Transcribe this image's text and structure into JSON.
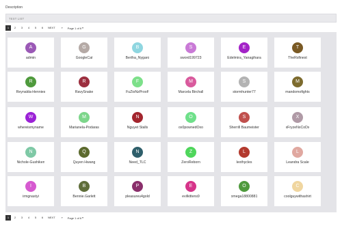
{
  "description_label": "Description",
  "list_header": "TEST LIST",
  "pager": {
    "pages": [
      "1",
      "2",
      "3",
      "4",
      "5",
      "6"
    ],
    "active": "1",
    "next_label": "NEXT",
    "last_label": "»",
    "page_of": "Page 1 of 6"
  },
  "users": [
    {
      "letter": "A",
      "name": "admin",
      "color": "#9b59b6"
    },
    {
      "letter": "G",
      "name": "GoogleCat",
      "color": "#b5aaa6"
    },
    {
      "letter": "B",
      "name": "Bertha_Nygaro",
      "color": "#8fd6e0"
    },
    {
      "letter": "S",
      "name": "sword199723",
      "color": "#c97ad6"
    },
    {
      "letter": "E",
      "name": "Edelmira_Yanagihara",
      "color": "#a323c7"
    },
    {
      "letter": "T",
      "name": "TheRsfinest",
      "color": "#7a5a25"
    },
    {
      "letter": "R",
      "name": "Reynalda-Hennies",
      "color": "#4f9a3d"
    },
    {
      "letter": "R",
      "name": "RavySnake",
      "color": "#9c2f3f"
    },
    {
      "letter": "F",
      "name": "FuZioNzProoF",
      "color": "#7de08a"
    },
    {
      "letter": "M",
      "name": "Marcela Birchall",
      "color": "#d95a9d"
    },
    {
      "letter": "S",
      "name": "stormhunter77",
      "color": "#b3b3b3"
    },
    {
      "letter": "M",
      "name": "mandomofights",
      "color": "#7d6b2e"
    },
    {
      "letter": "W",
      "name": "whereismyname",
      "color": "#9b22d6"
    },
    {
      "letter": "M",
      "name": "Marianela-Podaras",
      "color": "#7dd68b"
    },
    {
      "letter": "N",
      "name": "Nguyet Stalls",
      "color": "#a3262e"
    },
    {
      "letter": "O",
      "name": "ox0pownedOxo",
      "color": "#6fe08a"
    },
    {
      "letter": "S",
      "name": "Sherrill Baumeister",
      "color": "#c0504d"
    },
    {
      "letter": "X",
      "name": "xFryzeNxCoDx",
      "color": "#b09aa6"
    },
    {
      "letter": "N",
      "name": "Nichole-Gushiken",
      "color": "#7fc9a6"
    },
    {
      "letter": "Q",
      "name": "Quyen Hwang",
      "color": "#5c6a2e"
    },
    {
      "letter": "N",
      "name": "Need_TLC",
      "color": "#2f5f6b"
    },
    {
      "letter": "Z",
      "name": "ZeroReborn",
      "color": "#4fd65c"
    },
    {
      "letter": "L",
      "name": "leothycles",
      "color": "#b33a2e"
    },
    {
      "letter": "L",
      "name": "Leandra Scale",
      "color": "#e0a8a0"
    },
    {
      "letter": "I",
      "name": "irmgnastyi",
      "color": "#d65ad0"
    },
    {
      "letter": "B",
      "name": "Bennie.Garlett",
      "color": "#5f6e3a"
    },
    {
      "letter": "P",
      "name": "pleasureu4gold",
      "color": "#8a2f6b"
    },
    {
      "letter": "E",
      "name": "evilkittens9",
      "color": "#d6348a"
    },
    {
      "letter": "O",
      "name": "omega18800881",
      "color": "#4f9a3d"
    },
    {
      "letter": "C",
      "name": "coolguywithashirt",
      "color": "#f0d6a0"
    }
  ]
}
